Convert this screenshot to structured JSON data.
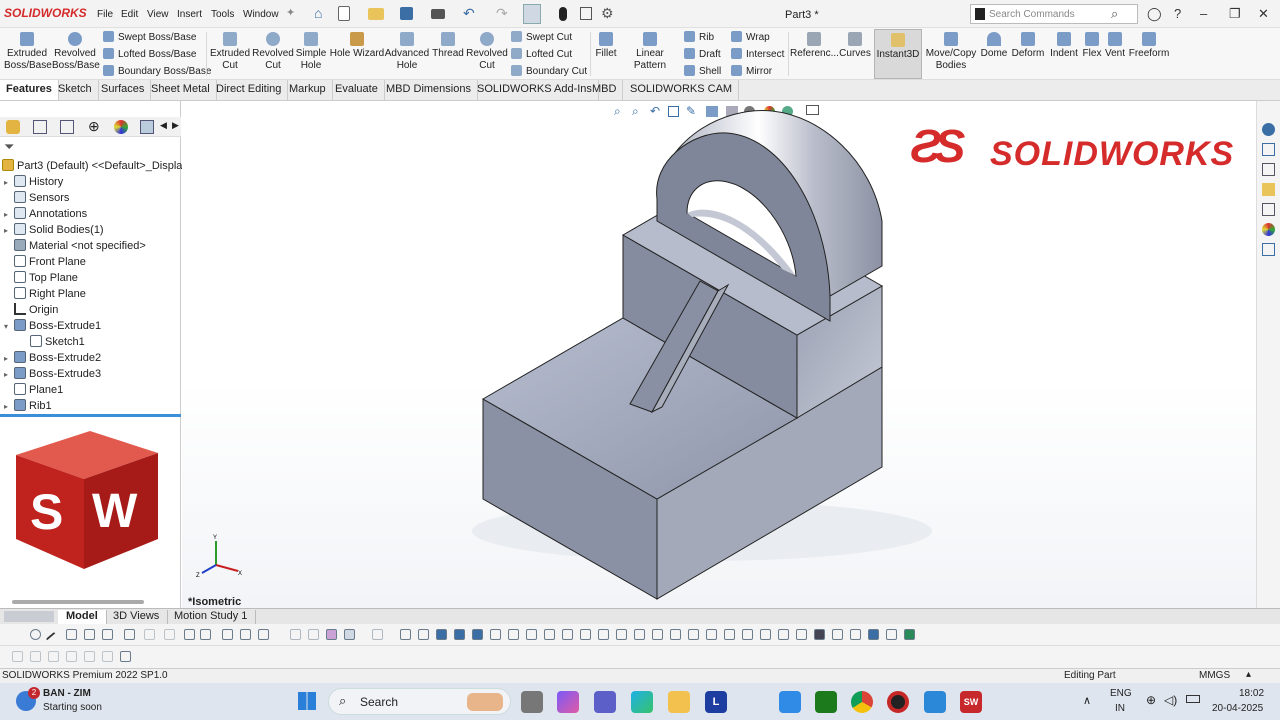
{
  "app": {
    "brand": "SOLIDWORKS",
    "doc_title": "Part3 *",
    "search_placeholder": "Search Commands",
    "accent": "#d52b2b"
  },
  "menus": [
    "File",
    "Edit",
    "View",
    "Insert",
    "Tools",
    "Window"
  ],
  "ribbon": {
    "extruded_boss": "Extruded Boss/Base",
    "revolved_boss": "Revolved Boss/Base",
    "swept_boss": "Swept Boss/Base",
    "lofted_boss": "Lofted Boss/Base",
    "boundary_boss": "Boundary Boss/Base",
    "extruded_cut": "Extruded Cut",
    "revolved_cut_a": "Revolved Cut",
    "simple_hole": "Simple Hole",
    "hole_wizard": "Hole Wizard",
    "advanced_hole": "Advanced Hole",
    "thread": "Thread",
    "revolved_cut_b": "Revolved Cut",
    "swept_cut": "Swept Cut",
    "lofted_cut": "Lofted Cut",
    "boundary_cut": "Boundary Cut",
    "fillet": "Fillet",
    "linear_pattern": "Linear Pattern",
    "rib": "Rib",
    "draft": "Draft",
    "shell": "Shell",
    "wrap": "Wrap",
    "intersect": "Intersect",
    "mirror": "Mirror",
    "reference": "Referenc...",
    "curves": "Curves",
    "instant3d": "Instant3D",
    "move_copy": "Move/Copy Bodies",
    "dome": "Dome",
    "deform": "Deform",
    "indent": "Indent",
    "flex": "Flex",
    "vent": "Vent",
    "freeform": "Freeform"
  },
  "tabs": [
    "Features",
    "Sketch",
    "Surfaces",
    "Sheet Metal",
    "Direct Editing",
    "Markup",
    "Evaluate",
    "MBD Dimensions",
    "SOLIDWORKS Add-Ins",
    "MBD",
    "SOLIDWORKS CAM"
  ],
  "tree": {
    "root": "Part3 (Default) <<Default>_Display S",
    "items": [
      "History",
      "Sensors",
      "Annotations",
      "Solid Bodies(1)",
      "Material <not specified>",
      "Front Plane",
      "Top Plane",
      "Right Plane",
      "Origin",
      "Boss-Extrude1",
      "Sketch1",
      "Boss-Extrude2",
      "Boss-Extrude3",
      "Plane1",
      "Rib1"
    ]
  },
  "viewport": {
    "view_label": "*Isometric",
    "watermark": "SOLIDWORKS",
    "badge": "SW"
  },
  "bottom_tabs": [
    "Model",
    "3D Views",
    "Motion Study 1"
  ],
  "status": {
    "left": "SOLIDWORKS Premium 2022 SP1.0",
    "mode": "Editing Part",
    "units": "MMGS"
  },
  "taskbar": {
    "weather_count": "2",
    "weather_title": "BAN - ZIM",
    "weather_sub": "Starting soon",
    "search": "Search",
    "lang": "ENG",
    "region": "IN",
    "time": "18:02",
    "date": "20-04-2025"
  }
}
